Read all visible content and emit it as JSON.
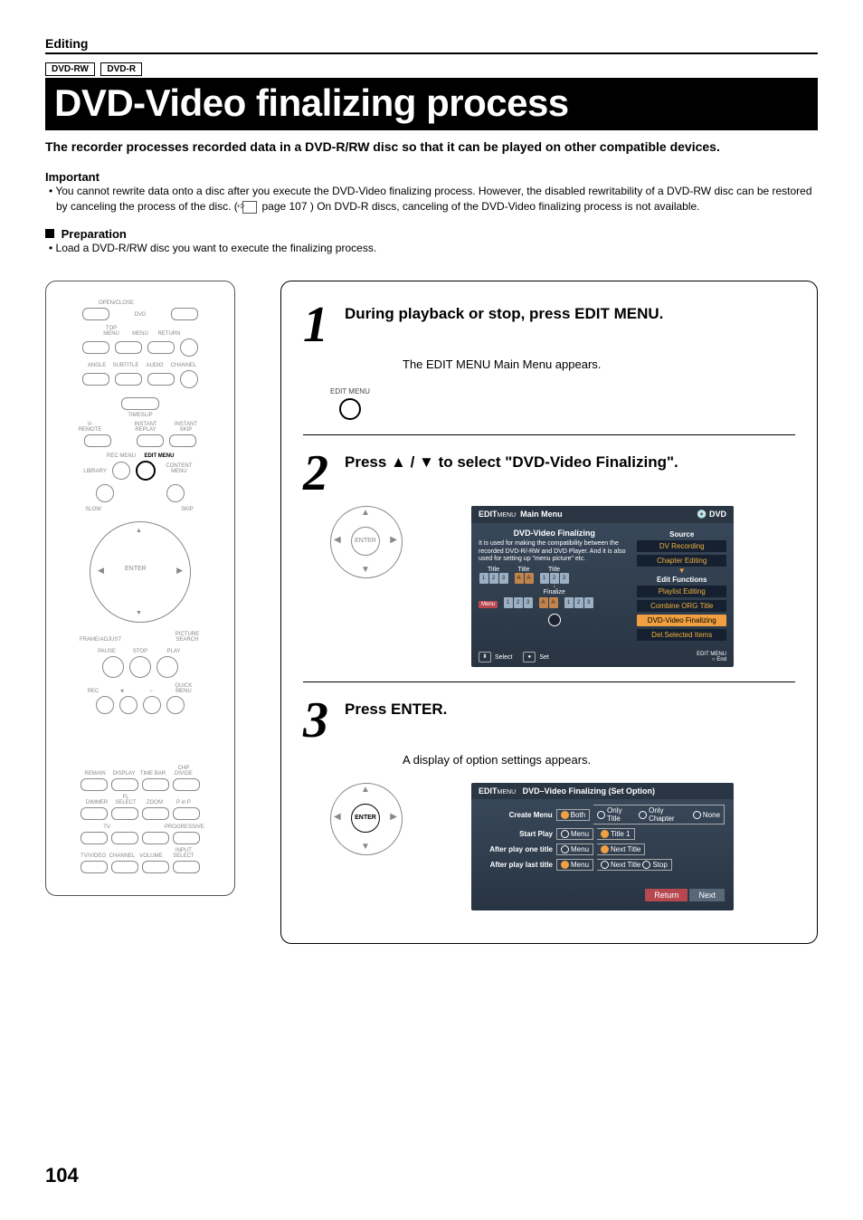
{
  "section": "Editing",
  "disc_tags": [
    "DVD-RW",
    "DVD-R"
  ],
  "title": "DVD-Video finalizing process",
  "intro": "The recorder processes recorded data in a DVD-R/RW disc so that it can be played on other compatible devices.",
  "important_heading": "Important",
  "important_bullet_pre": "• You cannot rewrite data onto a disc after you execute the DVD-Video finalizing process. However, the disabled rewritability of a DVD-RW disc can be restored by canceling the process of the disc. (",
  "important_bullet_ref": "page 107",
  "important_bullet_post": ") On DVD-R discs, canceling of the DVD-Video finalizing process is not available.",
  "prep_heading": "Preparation",
  "prep_bullet": "• Load a DVD-R/RW disc you want to execute the finalizing process.",
  "remote_labels": {
    "openclose": "OPEN/CLOSE",
    "dvd": "DVD",
    "topmenu": "TOP MENU",
    "menu": "MENU",
    "return": "RETURN",
    "angle": "ANGLE",
    "subtitle": "SUBTITLE",
    "audio": "AUDIO",
    "channel": "CHANNEL",
    "timeslip": "TIMESLIP",
    "vremote": "V-REMOTE",
    "instreplay": "INSTANT REPLAY",
    "instskip": "INSTANT SKIP",
    "recmenu": "REC MENU",
    "editmenu": "EDIT MENU",
    "library": "LIBRARY",
    "contentmenu": "CONTENT MENU",
    "slow": "SLOW",
    "skip": "SKIP",
    "enter": "ENTER",
    "frameadj": "FRAME/ADJUST",
    "picture": "PICTURE SEARCH",
    "pause": "PAUSE",
    "stop": "STOP",
    "play": "PLAY",
    "rec": "REC",
    "quickmenu": "QUICK MENU",
    "remain": "REMAIN",
    "display": "DISPLAY",
    "timebar": "TIME BAR",
    "chpdivide": "CHP DIVIDE",
    "dimmer": "DIMMER",
    "flselect": "FL SELECT",
    "zoom": "ZOOM",
    "pinp": "P in P",
    "tv": "TV",
    "progressive": "PROGRESSIVE",
    "tvvideo": "TV/VIDEO",
    "channel2": "CHANNEL",
    "volume": "VOLUME",
    "inputsel": "INPUT SELECT"
  },
  "step1": {
    "num": "1",
    "title": "During playback or stop, press EDIT MENU.",
    "editmenu_label": "EDIT MENU",
    "body": "The EDIT MENU Main Menu appears."
  },
  "step2": {
    "num": "2",
    "title": "Press ▲ / ▼ to select \"DVD-Video Finalizing\".",
    "dpad_enter": "ENTER",
    "screen": {
      "brand_prefix": "EDIT",
      "brand_suffix": "MENU",
      "head_title": "Main Menu",
      "head_dvd": "DVD",
      "left_title": "DVD-Video Finalizing",
      "desc": "It is used for making the compatibility between the recorded DVD-R/-RW and DVD Player. And it is also used for setting up \"menu picture\" etc.",
      "col_title": "Title",
      "finalize": "Finalize",
      "menu_tag": "Menu",
      "right_source": "Source",
      "right_items": [
        "DV Recording",
        "Chapter Editing"
      ],
      "arrow_dn": "▼",
      "right_editfn": "Edit Functions",
      "right_items2": [
        "Playlist Editing",
        "Combine ORG Title",
        "DVD-Video Finalizing",
        "Del.Selected Items"
      ],
      "foot_select": "Select",
      "foot_set": "Set",
      "foot_editmenu": "EDIT MENU",
      "foot_end": "End"
    }
  },
  "step3": {
    "num": "3",
    "title": "Press ENTER.",
    "dpad_enter": "ENTER",
    "body": "A display of option settings appears.",
    "screen": {
      "brand_prefix": "EDIT",
      "brand_suffix": "MENU",
      "head_title": "DVD–Video Finalizing (Set Option)",
      "rows": [
        {
          "label": "Create Menu",
          "opts": [
            "Both",
            "Only Title",
            "Only Chapter",
            "None"
          ],
          "sel": 0
        },
        {
          "label": "Start Play",
          "opts": [
            "Menu",
            "Title 1"
          ],
          "sel": 1
        },
        {
          "label": "After play one title",
          "opts": [
            "Menu",
            "Next Title"
          ],
          "sel": 1
        },
        {
          "label": "After play last title",
          "opts": [
            "Menu",
            "Next Title",
            "Stop"
          ],
          "sel": 0
        }
      ],
      "btn_return": "Return",
      "btn_next": "Next"
    }
  },
  "page_number": "104"
}
